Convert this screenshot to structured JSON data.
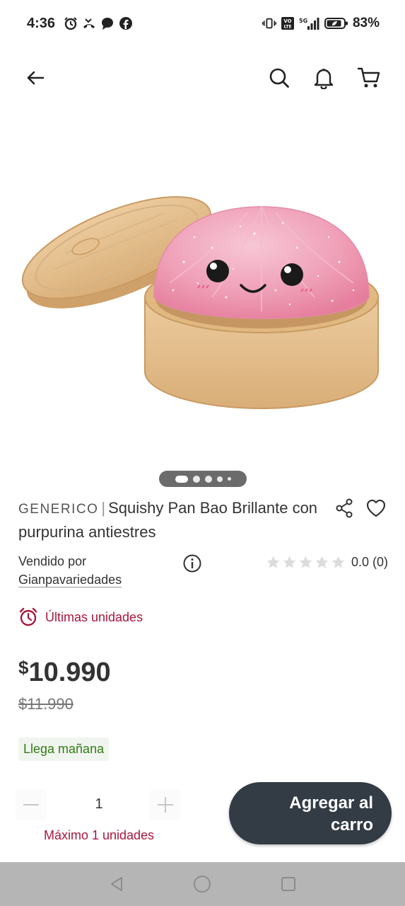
{
  "status_bar": {
    "time": "4:36",
    "battery": "83%",
    "network": "5G",
    "volte": "VO LTE",
    "icons": [
      "alarm-icon",
      "missed-call-icon",
      "chat-icon",
      "facebook-icon",
      "vibrate-icon",
      "volte-icon",
      "signal-icon",
      "battery-icon"
    ]
  },
  "nav": {
    "icons": [
      "back-arrow-icon",
      "search-icon",
      "bell-icon",
      "cart-icon"
    ]
  },
  "carousel": {
    "total_indicators": 5,
    "active_index": 0
  },
  "product": {
    "brand": "GENERICO",
    "separator": "|",
    "title": "Squishy Pan Bao Brillante con purpurina antiestres",
    "seller_label": "Vendido por",
    "seller_name": "Gianpavariedades",
    "rating_value": "0.0 (0)",
    "stars_filled": 0,
    "stars_total": 5,
    "stock_message": "Últimas unidades",
    "price_currency": "$",
    "price": "10.990",
    "old_price": "$11.990",
    "delivery_badge": "Llega mañana"
  },
  "quantity": {
    "value": "1",
    "max_message": "Máximo 1 unidades"
  },
  "cta": {
    "line1": "Agregar al",
    "line2": "carro"
  },
  "colors": {
    "accent_red": "#a8173d",
    "delivery_green": "#2f7d16",
    "cta_bg": "#333b44",
    "system_nav": "#b5b5b5"
  }
}
